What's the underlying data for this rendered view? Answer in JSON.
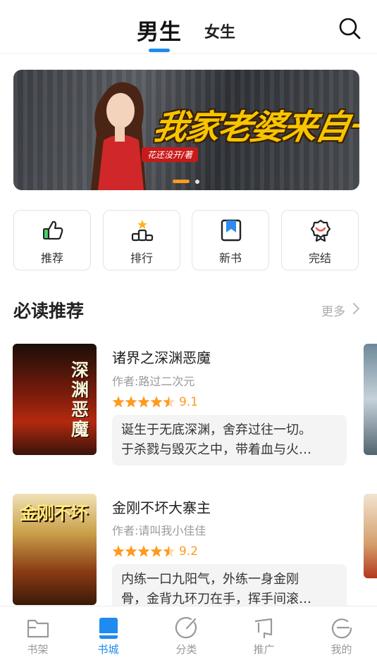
{
  "header": {
    "tab_male": "男生",
    "tab_female": "女生",
    "search_icon": "search-icon"
  },
  "banner": {
    "title": "我家老婆来自一千年前",
    "author": "花还没开/著",
    "slides_total": 2,
    "active_slide": 1
  },
  "quick_nav": [
    {
      "label": "推荐",
      "icon": "thumbs-up-icon"
    },
    {
      "label": "排行",
      "icon": "podium-star-icon"
    },
    {
      "label": "新书",
      "icon": "bookmark-book-icon"
    },
    {
      "label": "完结",
      "icon": "medal-icon"
    }
  ],
  "section": {
    "title": "必读推荐",
    "more_label": "更多"
  },
  "books": [
    {
      "title": "诸界之深渊恶魔",
      "author": "作者:路过二次元",
      "score": "9.1",
      "rating_stars": 4.5,
      "desc_line1": "诞生于无底深渊，舍弃过往一切。",
      "desc_line2": "于杀戮与毁灭之中，带着血与火…",
      "cover_text": "深渊恶魔"
    },
    {
      "title": "金刚不坏大寨主",
      "author": "作者:请叫我小佳佳",
      "score": "9.2",
      "rating_stars": 4.5,
      "desc_line1": "内练一口九阳气，外练一身金刚",
      "desc_line2": "骨，金背九环刀在手，挥手间滚…",
      "cover_text": "金刚不坏"
    }
  ],
  "tabbar": [
    {
      "label": "书架",
      "icon": "bookshelf-icon",
      "active": false
    },
    {
      "label": "书城",
      "icon": "bookstore-icon",
      "active": true
    },
    {
      "label": "分类",
      "icon": "category-icon",
      "active": false
    },
    {
      "label": "推广",
      "icon": "promote-icon",
      "active": false
    },
    {
      "label": "我的",
      "icon": "profile-icon",
      "active": false
    }
  ],
  "colors": {
    "accent": "#1e8bf0",
    "rating": "#ff9a1e"
  }
}
